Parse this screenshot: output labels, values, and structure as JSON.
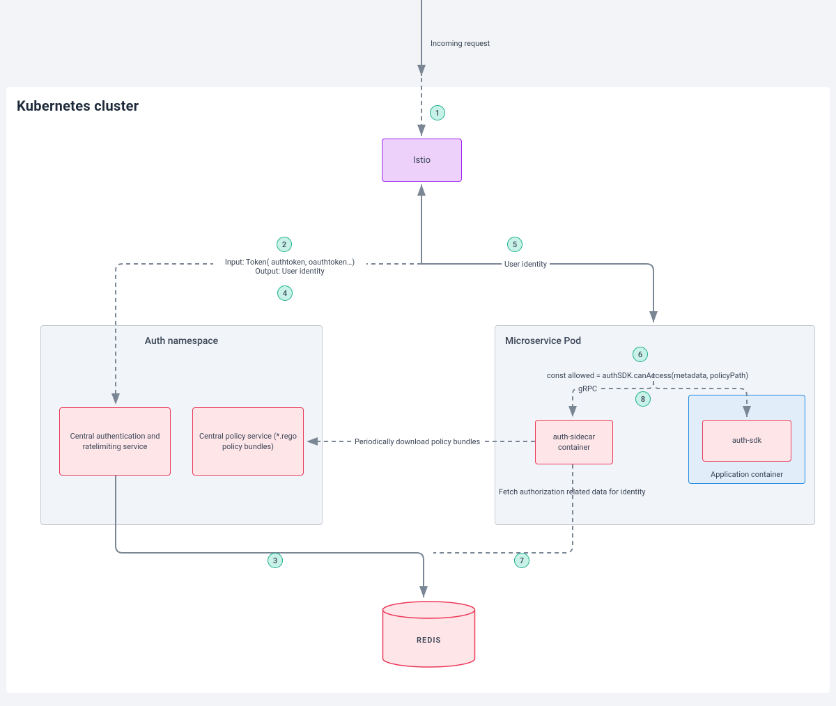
{
  "cluster": {
    "title": "Kubernetes cluster"
  },
  "namespaces": {
    "auth": {
      "title": "Auth namespace"
    },
    "msPod": {
      "title": "Microservice Pod"
    }
  },
  "boxes": {
    "istio": "Istio",
    "centralAuth": "Central authentication and ratelimiting service",
    "centralPolicy": "Central policy service (*.rego policy bundles)",
    "authSidecar": "auth-sidecar container",
    "authSdk": "auth-sdk",
    "appContainer": "Application container",
    "redis": "REDIS"
  },
  "labels": {
    "incoming": "Incoming request",
    "inputLine": "Input: Token( authtoken, oauthtoken…)",
    "outputLine": "Output: User identity",
    "userIdentity": "User identity",
    "canAccess": "const allowed = authSDK.canAccess(metadata,  policyPath)",
    "grpc": "gRPC",
    "policyDownload": "Periodically download policy bundles",
    "fetchAuth": "Fetch authorization related data for identity"
  },
  "steps": {
    "s1": "1",
    "s2": "2",
    "s3": "3",
    "s4": "4",
    "s5": "5",
    "s6": "6",
    "s7": "7",
    "s8": "8"
  }
}
